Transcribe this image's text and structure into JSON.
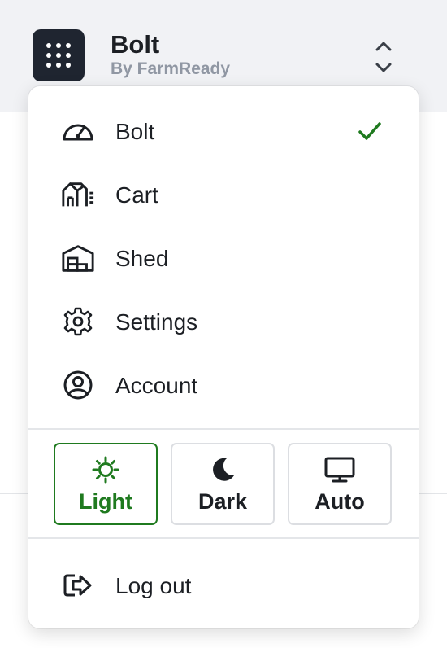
{
  "header": {
    "app_name": "Bolt",
    "app_subtitle": "By FarmReady"
  },
  "menu": {
    "items": [
      {
        "label": "Bolt",
        "icon": "gauge-icon",
        "selected": true
      },
      {
        "label": "Cart",
        "icon": "cart-icon",
        "selected": false
      },
      {
        "label": "Shed",
        "icon": "shed-icon",
        "selected": false
      },
      {
        "label": "Settings",
        "icon": "gear-icon",
        "selected": false
      },
      {
        "label": "Account",
        "icon": "user-circle-icon",
        "selected": false
      }
    ],
    "theme_options": [
      {
        "label": "Light",
        "icon": "sun-icon",
        "active": true
      },
      {
        "label": "Dark",
        "icon": "moon-icon",
        "active": false
      },
      {
        "label": "Auto",
        "icon": "monitor-icon",
        "active": false
      }
    ],
    "logout_label": "Log out"
  },
  "colors": {
    "accent": "#1f7a1f",
    "logo_bg": "#1f2530",
    "header_bg": "#f1f2f5",
    "subtitle": "#9097a3",
    "text": "#1c1f24"
  }
}
